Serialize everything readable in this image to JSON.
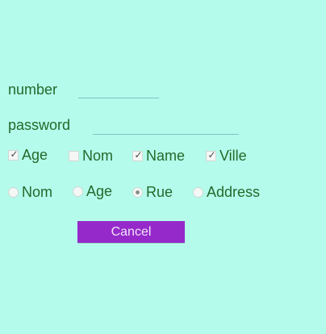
{
  "form": {
    "number_label": "number",
    "number_value": "",
    "password_label": "password",
    "password_value": ""
  },
  "checkboxes": [
    {
      "label": "Age",
      "checked": true
    },
    {
      "label": "Nom",
      "checked": false
    },
    {
      "label": "Name",
      "checked": true
    },
    {
      "label": "Ville",
      "checked": true
    }
  ],
  "radios": [
    {
      "label": "Nom",
      "selected": false
    },
    {
      "label": "Age",
      "selected": false
    },
    {
      "label": "Rue",
      "selected": true
    },
    {
      "label": "Address",
      "selected": false
    }
  ],
  "cancel_label": "Cancel",
  "colors": {
    "background": "#b5fbec",
    "text": "#23692a",
    "button": "#9629c9",
    "button_text": "#f1e4fb"
  }
}
